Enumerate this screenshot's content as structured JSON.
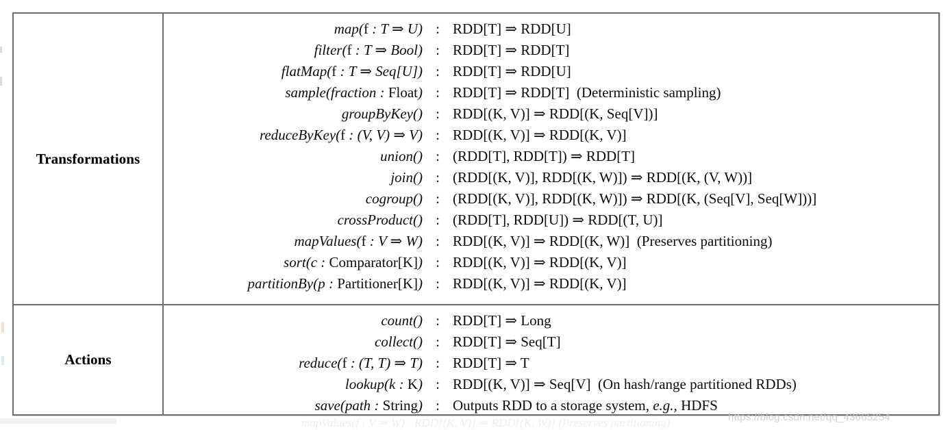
{
  "figure": {
    "kind": "api-reference-table",
    "border_color": "#6e6e6e"
  },
  "sections": [
    {
      "id": "transformations",
      "label": "Transformations",
      "rows": [
        {
          "name_html": "map(<span class=\"rm\">f</span> : T ⇒ U)",
          "colon": ":",
          "type_html": "RDD[T] ⇒ RDD[U]"
        },
        {
          "name_html": "filter(<span class=\"rm\">f</span> : T ⇒ Bool)",
          "colon": ":",
          "type_html": "RDD[T] ⇒ RDD[T]"
        },
        {
          "name_html": "flatMap(<span class=\"rm\">f</span> : T ⇒ Seq[U])",
          "colon": ":",
          "type_html": "RDD[T] ⇒ RDD[U]"
        },
        {
          "name_html": "sample(fraction : <span class=\"rm\">Float</span>)",
          "colon": ":",
          "type_html": "RDD[T] ⇒ RDD[T]&nbsp; (Deterministic sampling)"
        },
        {
          "name_html": "groupByKey()",
          "colon": ":",
          "type_html": "RDD[(K, V)] ⇒ RDD[(K, Seq[V])]"
        },
        {
          "name_html": "reduceByKey(<span class=\"rm\">f</span> : (V, V) ⇒ V)",
          "colon": ":",
          "type_html": "RDD[(K, V)] ⇒ RDD[(K, V)]"
        },
        {
          "name_html": "union()",
          "colon": ":",
          "type_html": "(RDD[T], RDD[T]) ⇒ RDD[T]"
        },
        {
          "name_html": "join()",
          "colon": ":",
          "type_html": "(RDD[(K, V)], RDD[(K, W)]) ⇒ RDD[(K, (V, W))]"
        },
        {
          "name_html": "cogroup()",
          "colon": ":",
          "type_html": "(RDD[(K, V)], RDD[(K, W)]) ⇒ RDD[(K, (Seq[V], Seq[W]))]"
        },
        {
          "name_html": "crossProduct()",
          "colon": ":",
          "type_html": "(RDD[T], RDD[U]) ⇒ RDD[(T, U)]"
        },
        {
          "name_html": "mapValues(<span class=\"rm\">f</span> : V ⇒ W)",
          "colon": ":",
          "type_html": "RDD[(K, V)] ⇒ RDD[(K, W)]&nbsp; (Preserves partitioning)"
        },
        {
          "name_html": "sort(c : <span class=\"rm\">Comparator[K]</span>)",
          "colon": ":",
          "type_html": "RDD[(K, V)] ⇒ RDD[(K, V)]"
        },
        {
          "name_html": "partitionBy(p : <span class=\"rm\">Partitioner[K]</span>)",
          "colon": ":",
          "type_html": "RDD[(K, V)] ⇒ RDD[(K, V)]"
        }
      ]
    },
    {
      "id": "actions",
      "label": "Actions",
      "rows": [
        {
          "name_html": "count()",
          "colon": ":",
          "type_html": "RDD[T] ⇒ Long"
        },
        {
          "name_html": "collect()",
          "colon": ":",
          "type_html": "RDD[T] ⇒ Seq[T]"
        },
        {
          "name_html": "reduce(<span class=\"rm\">f</span> : (T, T) ⇒ T)",
          "colon": ":",
          "type_html": "RDD[T] ⇒ T"
        },
        {
          "name_html": "lookup(k : <span class=\"rm\">K</span>)",
          "colon": ":",
          "type_html": "RDD[(K, V)] ⇒ Seq[V]&nbsp; (On hash/range partitioned RDDs)"
        },
        {
          "name_html": "save(path : <span class=\"rm\">String</span>)",
          "colon": ":",
          "type_html": "Outputs RDD to a storage system, <span class=\"it\">e.g.,</span> HDFS"
        }
      ]
    }
  ],
  "artifacts": {
    "watermark": "https://blog.csdn.net/qq_43665254",
    "ghost_line": "mapValues(f : V ⇒ W)     :     RDD[(K, V)] ⇒ RDD[(K, W)]  (Preserves partitioning)"
  }
}
